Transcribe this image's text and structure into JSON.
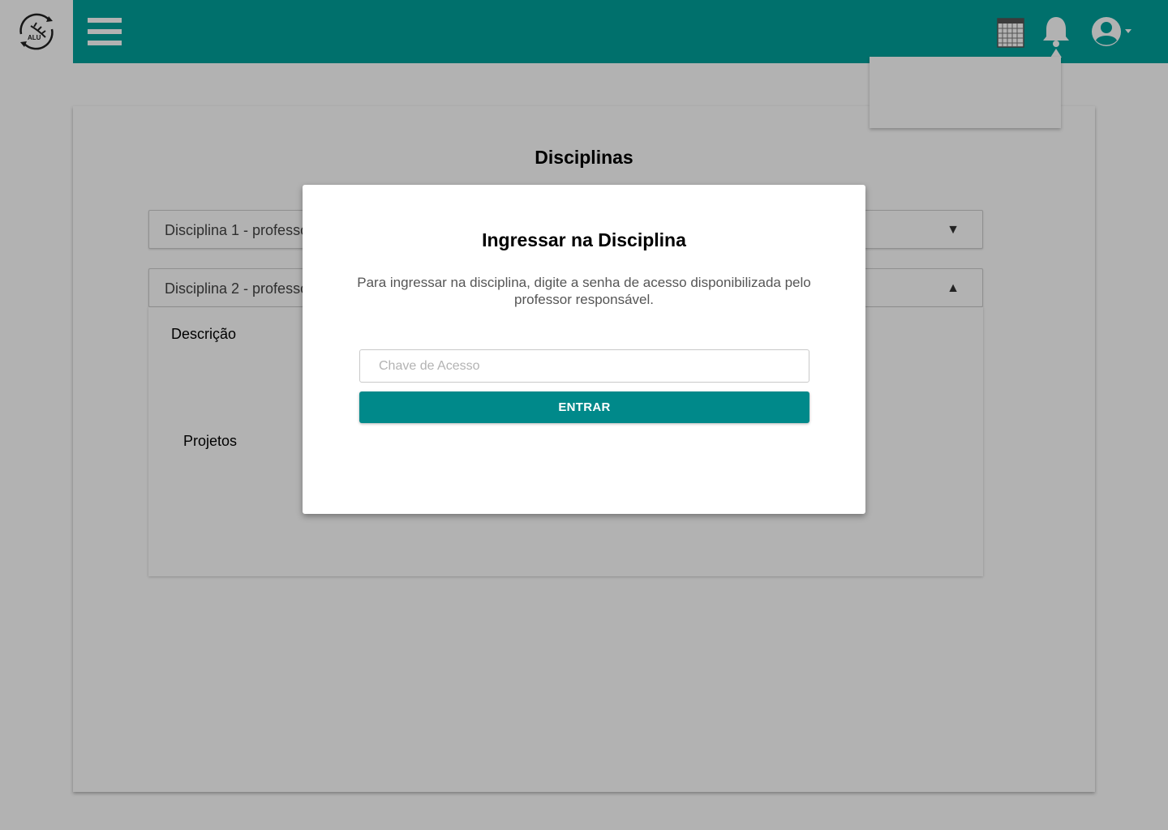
{
  "header": {
    "logo_text": "ALU",
    "icons": [
      "menu-icon",
      "calendar-icon",
      "bell-icon",
      "user-icon"
    ],
    "accent_color": "#00a19b"
  },
  "page": {
    "title": "Disciplinas",
    "accordions": [
      {
        "label": "Disciplina 1 - professor",
        "arrow": "▼",
        "expanded": false
      },
      {
        "label": "Disciplina 2 - professor",
        "arrow": "▲",
        "expanded": true
      }
    ],
    "expanded_sections": {
      "description_label": "Descrição",
      "projects_label": "Projetos"
    }
  },
  "modal": {
    "title": "Ingressar na Disciplina",
    "text": "Para ingressar na disciplina, digite a senha de acesso disponibilizada pelo professor responsável.",
    "input_placeholder": "Chave de Acesso",
    "input_value": "",
    "button_label": "ENTRAR",
    "button_color": "#00898a"
  }
}
